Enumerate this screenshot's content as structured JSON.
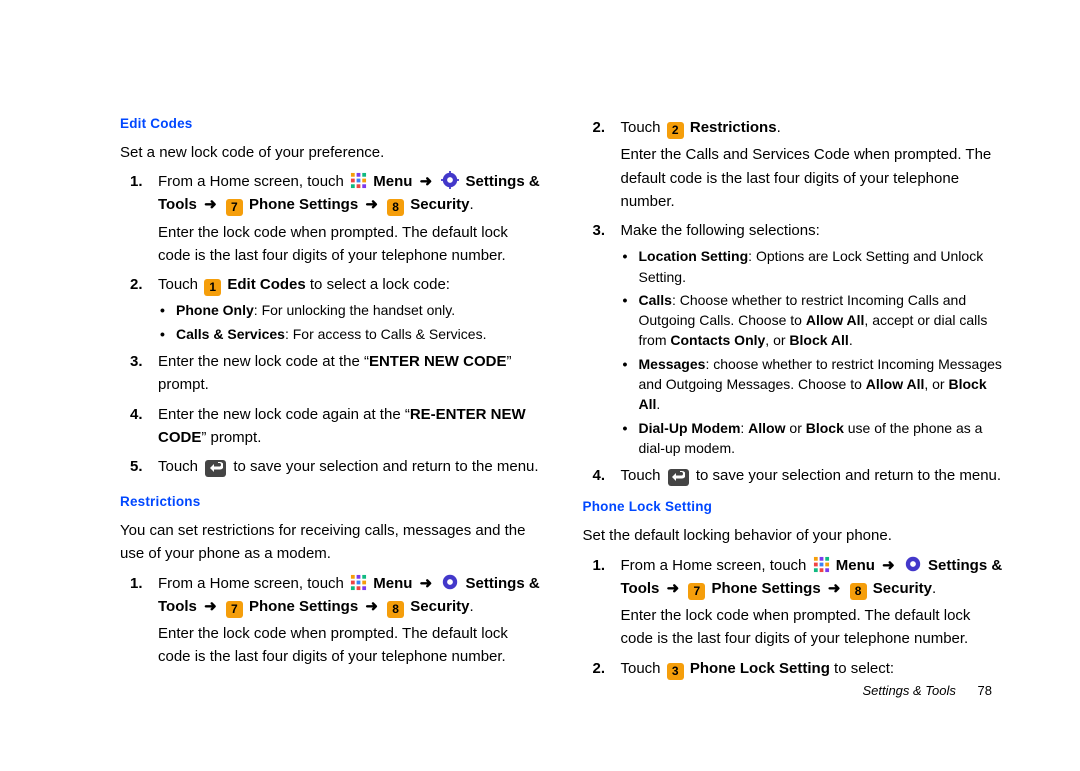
{
  "icons": {
    "menu": "Menu",
    "settings_tools": "Settings & Tools",
    "phone_settings": "Phone Settings",
    "security": "Security",
    "badge7": "7",
    "badge8": "8",
    "badge1": "1",
    "badge2": "2",
    "badge3": "3",
    "arrow": "➜"
  },
  "left": {
    "edit_codes": {
      "heading": "Edit Codes",
      "intro": "Set a new lock code of your preference.",
      "s1_pre": "From a Home screen, touch ",
      "s1_post": ".",
      "s1_note": "Enter the lock code when prompted. The default lock code is the last four digits of your telephone number.",
      "s2_pre": "Touch ",
      "s2_b": "Edit Codes",
      "s2_post": " to select a lock code:",
      "s2_opt1_b": "Phone Only",
      "s2_opt1_t": ": For unlocking the handset only.",
      "s2_opt2_b": "Calls & Services",
      "s2_opt2_t": ": For access to Calls & Services.",
      "s3_pre": "Enter the new lock code at the “",
      "s3_b": "ENTER NEW CODE",
      "s3_post": "” prompt.",
      "s4_pre": "Enter the new lock code again at the “",
      "s4_b": "RE-ENTER NEW CODE",
      "s4_post": "” prompt.",
      "s5_pre": "Touch ",
      "s5_post": " to save your selection and return to the menu."
    },
    "restrictions": {
      "heading": "Restrictions",
      "intro": "You can set restrictions for receiving calls, messages and the use of your phone as a modem.",
      "s1_pre": "From a Home screen, touch ",
      "s1_post": ".",
      "s1_note": "Enter the lock code when prompted. The default lock code is the last four digits of your telephone number."
    }
  },
  "right": {
    "restrictions_cont": {
      "s2_pre": "Touch ",
      "s2_b": "Restrictions",
      "s2_post": ".",
      "s2_note": "Enter the Calls and Services Code when prompted. The default code is the last four digits of your telephone number.",
      "s3": "Make the following selections:",
      "opt1_b": "Location Setting",
      "opt1_t": ": Options are Lock Setting and Unlock Setting.",
      "opt2_b": "Calls",
      "opt2_t1": ": Choose whether to restrict Incoming Calls and Outgoing Calls.  Choose to ",
      "opt2_b2": "Allow All",
      "opt2_t2": ", accept or dial calls from ",
      "opt2_b3": "Contacts Only",
      "opt2_t3": ", or ",
      "opt2_b4": "Block All",
      "opt2_t4": ".",
      "opt3_b": "Messages",
      "opt3_t1": ": choose whether to restrict Incoming Messages and Outgoing Messages. Choose to ",
      "opt3_b2": "Allow All",
      "opt3_t2": ", or ",
      "opt3_b3": "Block All",
      "opt3_t3": ".",
      "opt4_b": "Dial-Up Modem",
      "opt4_t1": ": ",
      "opt4_b2": "Allow",
      "opt4_t2": " or ",
      "opt4_b3": "Block",
      "opt4_t3": " use of the phone as a dial-up modem.",
      "s4_pre": "Touch ",
      "s4_post": " to save your selection and return to the menu."
    },
    "phone_lock": {
      "heading": "Phone Lock Setting",
      "intro": "Set the default locking behavior of your phone.",
      "s1_pre": "From a Home screen, touch ",
      "s1_post": ".",
      "s1_note": "Enter the lock code when prompted. The default lock code is the last four digits of your telephone number.",
      "s2_pre": "Touch ",
      "s2_b": "Phone Lock Setting",
      "s2_post": " to select:"
    }
  },
  "footer": {
    "section": "Settings & Tools",
    "page": "78"
  }
}
